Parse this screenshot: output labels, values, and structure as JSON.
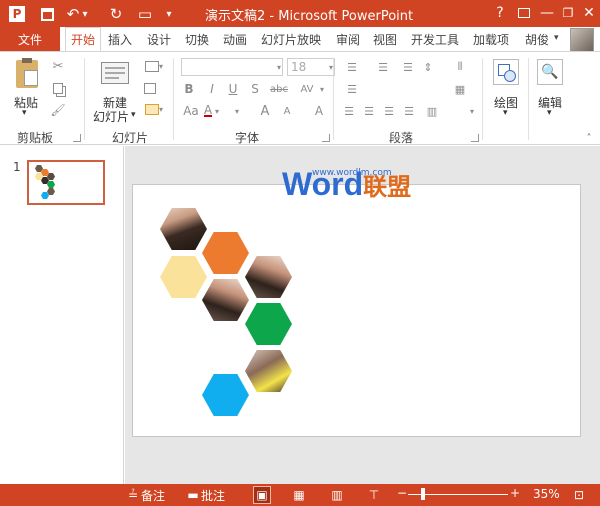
{
  "window": {
    "title": "演示文稿2 - Microsoft PowerPoint",
    "help": "?",
    "minimize": "—",
    "restore": "❐",
    "close": "✕"
  },
  "quick_access": {
    "app_icon": "P",
    "save": "💾",
    "undo": "↶",
    "undo_arrow": "▾",
    "redo": "↻",
    "start_slideshow": "▭",
    "customize": "▾"
  },
  "tabs": {
    "file": "文件",
    "items": [
      "开始",
      "插入",
      "设计",
      "切换",
      "动画",
      "幻灯片放映",
      "审阅",
      "视图",
      "开发工具",
      "加载项"
    ],
    "user": "胡俊",
    "user_menu": "▾"
  },
  "ribbon": {
    "clipboard": {
      "label": "剪贴板",
      "paste": "粘贴",
      "paste_arrow": "▾"
    },
    "slides": {
      "label": "幻灯片",
      "new_slide_line1": "新建",
      "new_slide_line2": "幻灯片",
      "arrow": "▾"
    },
    "font": {
      "label": "字体",
      "size": "18",
      "bold": "B",
      "italic": "I",
      "underline": "U",
      "shadow": "S",
      "strike": "abc",
      "spacing": "AV",
      "case": "Aa",
      "grow": "A",
      "shrink": "A",
      "clear": "A"
    },
    "paragraph": {
      "label": "段落"
    },
    "drawing": {
      "label": "绘图",
      "arrow": "▾"
    },
    "editing": {
      "label": "编辑",
      "arrow": "▾"
    }
  },
  "slide_pane": {
    "slide_number": "1"
  },
  "watermark": {
    "url": "www.wordlm.com",
    "brand_main": "Word",
    "brand_sub": "联盟"
  },
  "colors": {
    "accent": "#d04423",
    "hex_orange": "#ec7a2f",
    "hex_yellow": "#fbe29a",
    "hex_green": "#0da64a",
    "hex_blue": "#10aeef"
  },
  "statusbar": {
    "notes": "备注",
    "comments": "批注",
    "zoom_minus": "−",
    "zoom_plus": "+",
    "zoom": "35%"
  }
}
